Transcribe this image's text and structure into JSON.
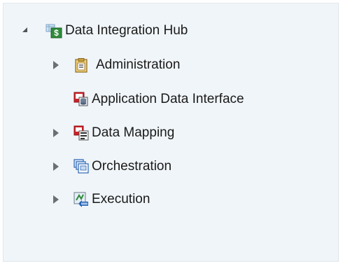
{
  "tree": {
    "root": {
      "label": "Data Integration Hub",
      "icon": "data-integration-hub-icon",
      "expanded": true
    },
    "items": [
      {
        "label": "Administration",
        "icon": "clipboard-icon",
        "has_children": true,
        "expanded": false
      },
      {
        "label": "Application Data Interface",
        "icon": "application-data-interface-icon",
        "has_children": false
      },
      {
        "label": "Data Mapping",
        "icon": "data-mapping-icon",
        "has_children": true,
        "expanded": false
      },
      {
        "label": "Orchestration",
        "icon": "orchestration-icon",
        "has_children": true,
        "expanded": false
      },
      {
        "label": "Execution",
        "icon": "execution-icon",
        "has_children": true,
        "expanded": false
      }
    ]
  },
  "colors": {
    "panel_bg": "#f0f5f9",
    "text": "#1a1a1a",
    "toggle": "#6b6f73",
    "accent_red": "#d21f26",
    "accent_blue": "#2b66b5",
    "accent_green": "#2e8b3a"
  }
}
